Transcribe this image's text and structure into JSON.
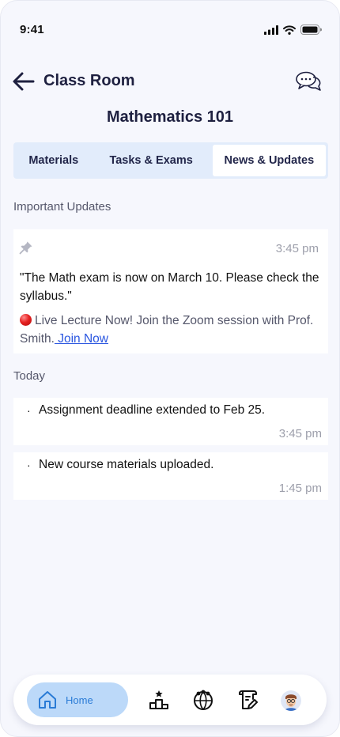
{
  "status_bar": {
    "time": "9:41"
  },
  "header": {
    "title": "Class Room",
    "back_icon": "arrow-left-icon",
    "chat_icon": "chat-bubbles-icon"
  },
  "course": {
    "title": "Mathematics 101"
  },
  "tabs": [
    {
      "label": "Materials",
      "active": false
    },
    {
      "label": "Tasks & Exams",
      "active": false
    },
    {
      "label": "News & Updates",
      "active": true
    }
  ],
  "important_updates": {
    "heading": "Important Updates",
    "pinned": {
      "icon": "pin-icon",
      "time": "3:45 pm",
      "quote": "\"The Math exam is now on March 10. Please check the syllabus.\"",
      "live_text": "Live Lecture Now! Join the Zoom session with Prof. Smith.",
      "link_label": " Join Now"
    }
  },
  "today": {
    "heading": "Today",
    "items": [
      {
        "bullet": "·",
        "text": "Assignment deadline extended to Feb 25.",
        "time": "3:45 pm"
      },
      {
        "bullet": "·",
        "text": "New course materials uploaded.",
        "time": "1:45 pm"
      }
    ]
  },
  "bottom_nav": {
    "home_label": "Home",
    "items": [
      "home-icon",
      "podium-icon",
      "community-icon",
      "certificate-icon",
      "profile-avatar"
    ]
  },
  "colors": {
    "accent": "#2a7bd6",
    "tab_bg": "#e2ecfb",
    "link": "#2a56e0",
    "background": "#f6f7fd"
  }
}
